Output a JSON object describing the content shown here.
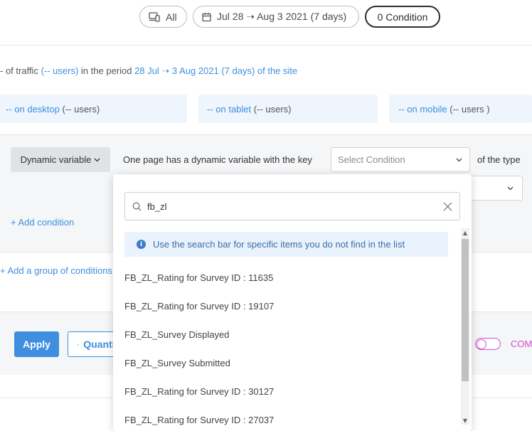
{
  "filters": {
    "device_label": "All",
    "date_range": "Jul 28 ➝ Aug 3 2021 (7 days)",
    "condition_label": "0 Condition"
  },
  "traffic": {
    "prefix": "- of traffic",
    "users": "(-- users)",
    "middle": "in the period",
    "period": "28 Jul ➝ 3 Aug 2021 (7 days) of the site"
  },
  "devices": {
    "desktop": {
      "label": "-- on desktop",
      "users": "(-- users)"
    },
    "tablet": {
      "label": "-- on tablet",
      "users": "(-- users)"
    },
    "mobile": {
      "label": "-- on mobile",
      "users": "(-- users )"
    }
  },
  "condition": {
    "variable_button": "Dynamic variable",
    "description": "One page has a dynamic variable with the key",
    "select_placeholder": "Select Condition",
    "type_text": "of the type",
    "add_condition": "+ Add condition",
    "add_group": "+ Add a group of conditions"
  },
  "actions": {
    "apply": "Apply",
    "quantify": "Quantify",
    "compare": "COMPARE"
  },
  "dropdown": {
    "search_value": "fb_zl",
    "info": "Use the search bar for specific items you do not find in the list",
    "items": [
      "FB_ZL_Rating for Survey ID : 11635",
      "FB_ZL_Rating for Survey ID : 19107",
      "FB_ZL_Survey Displayed",
      "FB_ZL_Survey Submitted",
      "FB_ZL_Rating for Survey ID : 30127",
      "FB_ZL_Rating for Survey ID : 27037"
    ]
  },
  "colors": {
    "accent": "#3f8ee0",
    "compare": "#d04fd0"
  }
}
